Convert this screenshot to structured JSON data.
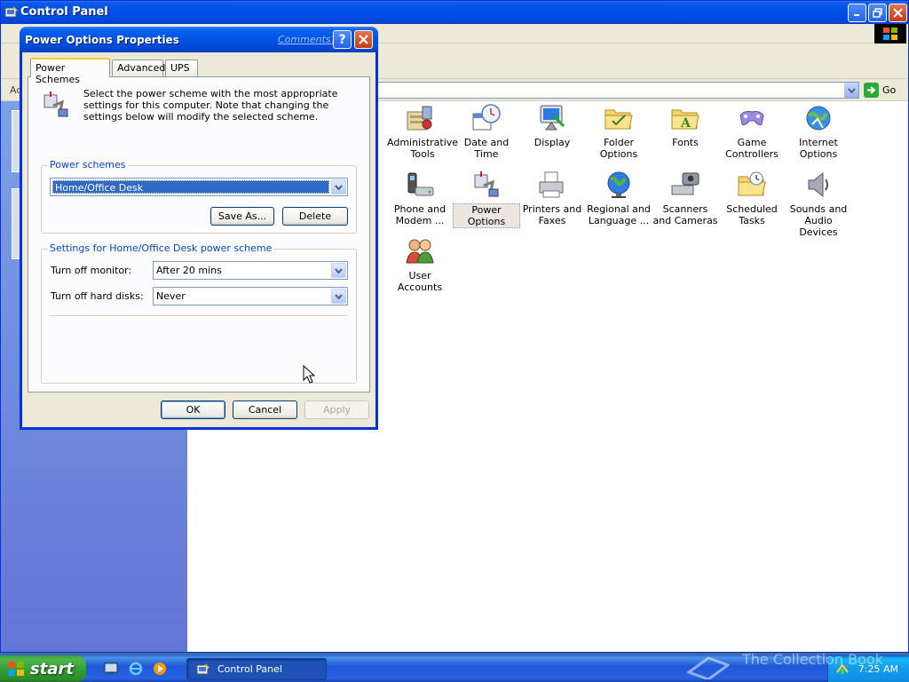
{
  "window": {
    "title": "Control Panel",
    "address_label": "Ac",
    "go_label": "Go"
  },
  "icons": [
    {
      "label": "Administrative Tools",
      "icon": "administrative-tools-icon"
    },
    {
      "label": "Date and Time",
      "icon": "date-time-icon"
    },
    {
      "label": "Display",
      "icon": "display-icon"
    },
    {
      "label": "Folder Options",
      "icon": "folder-options-icon"
    },
    {
      "label": "Fonts",
      "icon": "fonts-icon"
    },
    {
      "label": "Game Controllers",
      "icon": "game-controllers-icon"
    },
    {
      "label": "Internet Options",
      "icon": "internet-options-icon"
    },
    {
      "label": "Phone and Modem ...",
      "icon": "phone-modem-icon"
    },
    {
      "label": "Power Options",
      "icon": "power-options-icon"
    },
    {
      "label": "Printers and Faxes",
      "icon": "printers-faxes-icon"
    },
    {
      "label": "Regional and Language ...",
      "icon": "regional-language-icon"
    },
    {
      "label": "Scanners and Cameras",
      "icon": "scanners-cameras-icon"
    },
    {
      "label": "Scheduled Tasks",
      "icon": "scheduled-tasks-icon"
    },
    {
      "label": "Sounds and Audio Devices",
      "icon": "sounds-audio-icon"
    },
    {
      "label": "User Accounts",
      "icon": "user-accounts-icon"
    }
  ],
  "dialog": {
    "title": "Power Options Properties",
    "comments_link": "Comments?",
    "tabs": [
      "Power Schemes",
      "Advanced",
      "UPS"
    ],
    "intro": "Select the power scheme with the most appropriate settings for this computer. Note that changing the settings below will modify the selected scheme.",
    "schemes_group_label": "Power schemes",
    "selected_scheme": "Home/Office Desk",
    "save_as_label": "Save As...",
    "delete_label": "Delete",
    "settings_group_label": "Settings for Home/Office Desk power scheme",
    "monitor_label": "Turn off monitor:",
    "monitor_value": "After 20 mins",
    "disks_label": "Turn off hard disks:",
    "disks_value": "Never",
    "ok_label": "OK",
    "cancel_label": "Cancel",
    "apply_label": "Apply"
  },
  "taskbar": {
    "start_label": "start",
    "task_label": "Control Panel",
    "clock": "7:25 AM"
  },
  "watermark": "The Collection Book",
  "colors": {
    "titlebar_blue": "#0054e3",
    "start_green": "#36a036",
    "tray_blue": "#139beb",
    "group_legend_blue": "#0046d5",
    "selection_blue": "#316ac5"
  }
}
